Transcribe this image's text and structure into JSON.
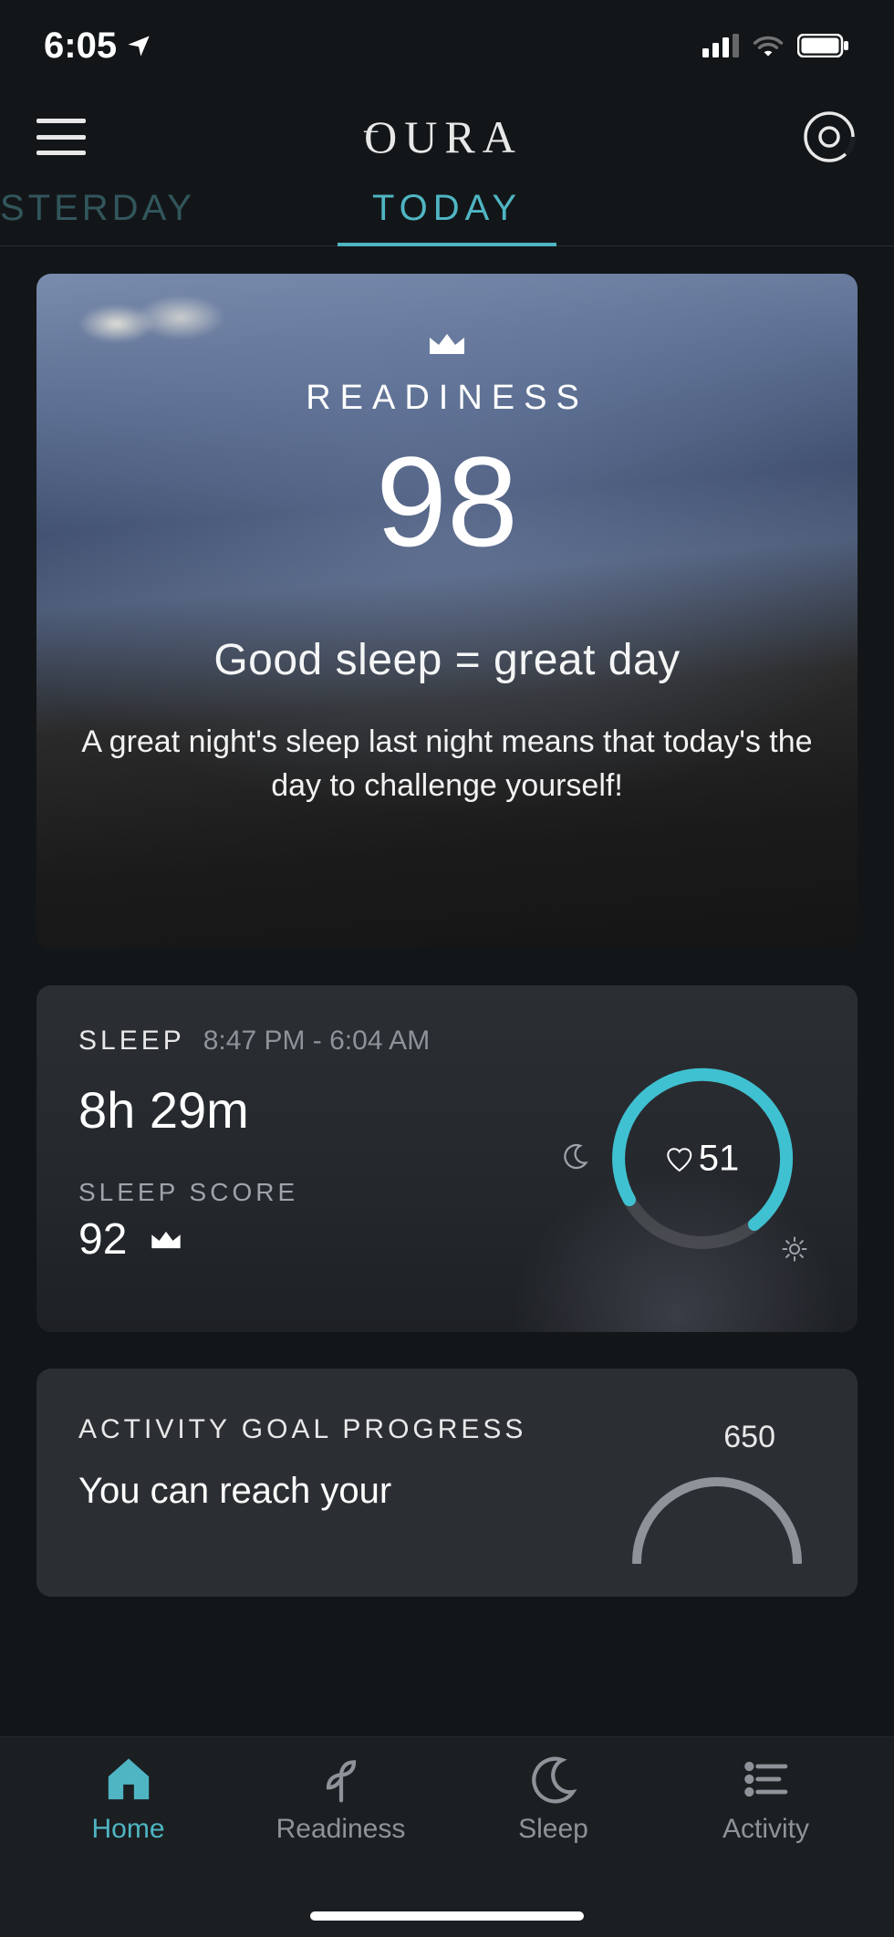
{
  "status_bar": {
    "time": "6:05"
  },
  "header": {
    "brand": "OURA"
  },
  "day_tabs": {
    "prev": "STERDAY",
    "current": "TODAY"
  },
  "readiness": {
    "label": "READINESS",
    "score": "98",
    "headline": "Good sleep = great day",
    "subtext": "A great night's sleep last night means that today's the day to challenge yourself!"
  },
  "sleep": {
    "label": "SLEEP",
    "time_range": "8:47 PM - 6:04 AM",
    "duration": "8h 29m",
    "score_label": "SLEEP SCORE",
    "score": "92",
    "resting_hr": "51"
  },
  "activity": {
    "title": "ACTIVITY GOAL PROGRESS",
    "subtext": "You can reach your",
    "goal": "650"
  },
  "nav": {
    "home": "Home",
    "readiness": "Readiness",
    "sleep": "Sleep",
    "activity": "Activity"
  }
}
